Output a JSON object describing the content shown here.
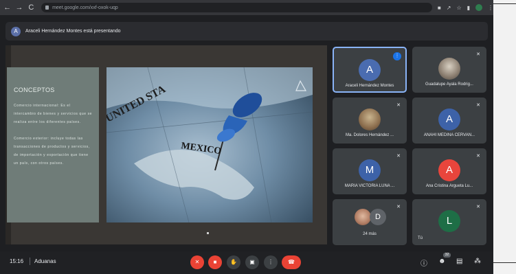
{
  "browser": {
    "url": "meet.google.com/xxf-oxok-uqp",
    "nav": {
      "back": "←",
      "forward": "→",
      "reload": "C"
    }
  },
  "presenting_banner": {
    "avatar_letter": "A",
    "text": "Araceli Hernández Montes está presentando"
  },
  "slide": {
    "title": "CONCEPTOS",
    "para1": "Comercio internacional: Es el intercambio de bienes y servicios que se realiza entre los diferentes países.",
    "para2": "Comercio exterior: incluye todas las transacciones de productos y servicios, de importación y exportación que tiene un país, con otros países.",
    "map_labels": [
      "UNITED STA",
      "MEXICO"
    ]
  },
  "participants": [
    {
      "name": "Araceli Hernández Montes",
      "letter": "A",
      "color": "#4a6cb0",
      "speaking": true
    },
    {
      "name": "Guadalupe Ayala Rodrig...",
      "letter": "",
      "color": "",
      "photo": "photo1"
    },
    {
      "name": "Ma. Dolores Hernández ...",
      "letter": "",
      "color": "",
      "photo": "photo2"
    },
    {
      "name": "ANAHI MEDINA CERVAN...",
      "letter": "A",
      "color": "#3d62a8"
    },
    {
      "name": "MARIA VICTORIA LUNA ...",
      "letter": "M",
      "color": "#3d62a8"
    },
    {
      "name": "Ana Cristina Argueta Lu...",
      "letter": "A",
      "color": "#e8453c"
    },
    {
      "name": "24 más",
      "letter": "D",
      "color": "#5f6368",
      "photo": "photo3"
    },
    {
      "name": "Tú",
      "letter": "L",
      "color": "#1e6e46"
    }
  ],
  "bottom": {
    "time": "15:16",
    "meeting_name": "Aduanas",
    "people_count": "32"
  },
  "icons": {
    "mic_off": "mic-off-icon",
    "cam_off": "camera-off-icon",
    "hand": "raise-hand-icon",
    "present": "present-screen-icon",
    "more": "more-options-icon",
    "end_call": "end-call-icon",
    "info": "info-icon",
    "people": "people-icon",
    "chat": "chat-icon",
    "activities": "activities-icon"
  }
}
